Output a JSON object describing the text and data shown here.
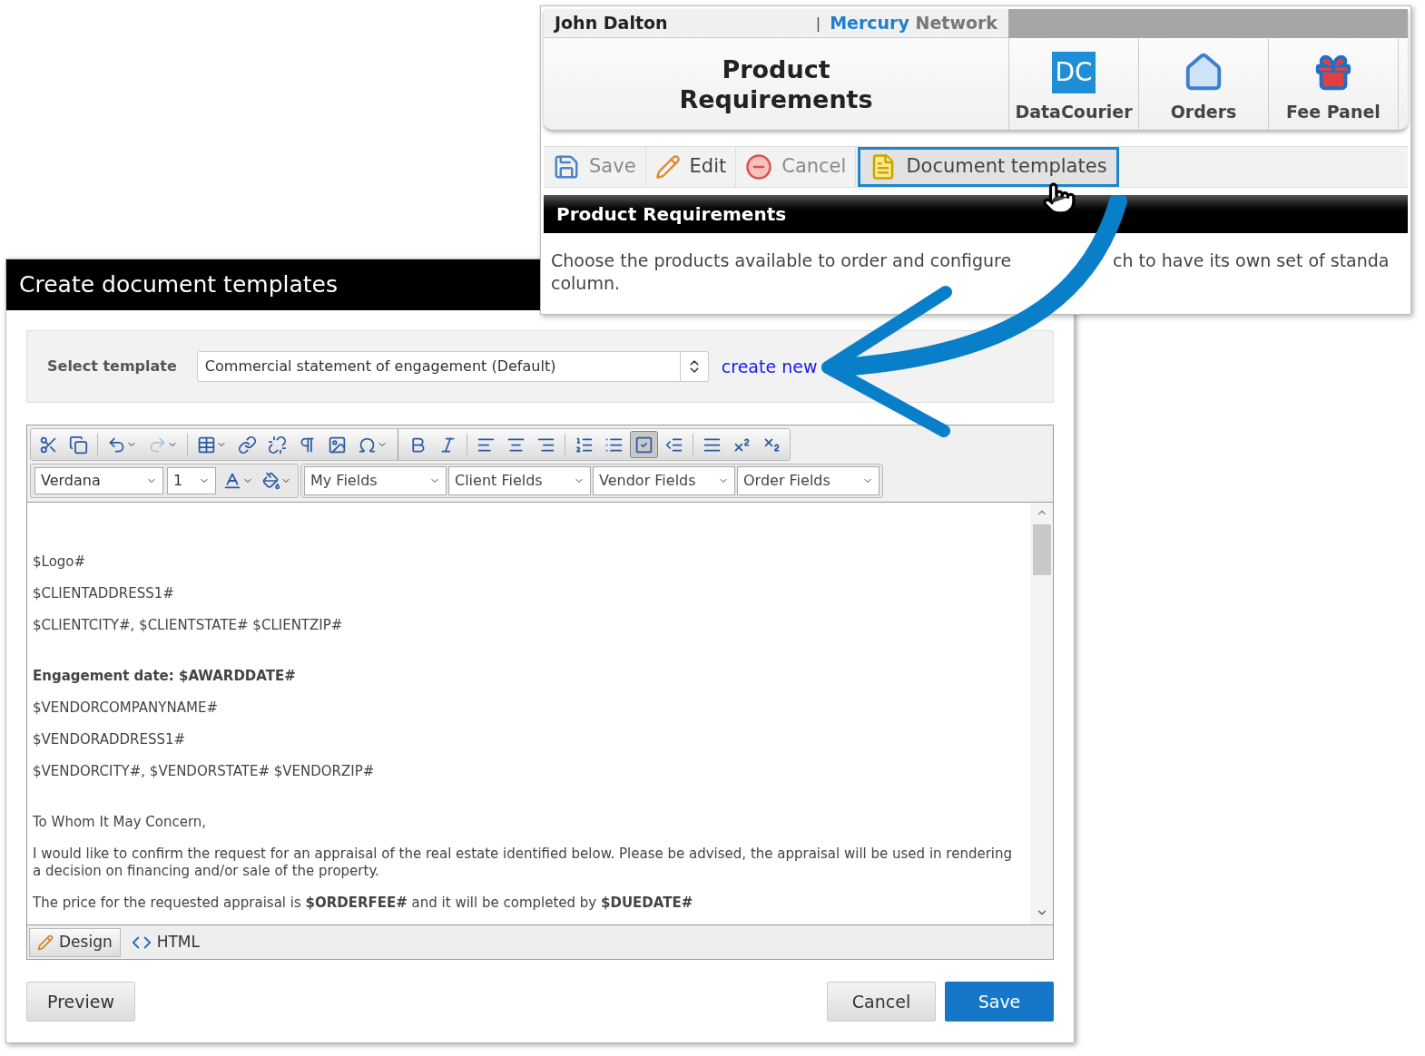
{
  "portal": {
    "user": "John Dalton",
    "separator": "|",
    "brand": [
      "Mercury",
      "Network"
    ],
    "page_title": "Product Requirements",
    "nav": [
      {
        "label": "DataCourier",
        "kind": "datacourier",
        "badge": "DC"
      },
      {
        "label": "Orders",
        "kind": "orders"
      },
      {
        "label": "Fee Panel",
        "kind": "fees"
      }
    ],
    "actions": [
      {
        "label": "Save",
        "kind": "save",
        "disabled": true,
        "selected": false
      },
      {
        "label": "Edit",
        "kind": "edit",
        "disabled": false,
        "selected": false
      },
      {
        "label": "Cancel",
        "kind": "cancel",
        "disabled": true,
        "selected": false
      },
      {
        "label": "Document templates",
        "kind": "templates",
        "disabled": false,
        "selected": true
      }
    ],
    "section_title": "Product Requirements",
    "description": [
      [
        "Choose the products available to order and configure",
        "ch to have its own set of standa"
      ],
      [
        "column."
      ]
    ]
  },
  "dialog": {
    "title": "Create document templates",
    "select_label": "Select template",
    "select_value": "Commercial statement of engagement (Default)",
    "create_link": "create new",
    "toolbar": [
      {
        "kind": "cut",
        "disabled": false,
        "selected": false
      },
      {
        "kind": "copy",
        "disabled": false,
        "selected": false
      },
      {
        "kind": "sep"
      },
      {
        "kind": "undo",
        "disabled": false,
        "selected": false
      },
      {
        "kind": "redo",
        "disabled": true,
        "selected": false
      },
      {
        "kind": "sep"
      },
      {
        "kind": "table",
        "disabled": false,
        "selected": false
      },
      {
        "kind": "link",
        "disabled": false,
        "selected": false
      },
      {
        "kind": "unlink",
        "disabled": false,
        "selected": false
      },
      {
        "kind": "paragraph",
        "disabled": false,
        "selected": false
      },
      {
        "kind": "image",
        "disabled": false,
        "selected": false
      },
      {
        "kind": "symbol",
        "disabled": false,
        "selected": false
      },
      {
        "kind": "group"
      },
      {
        "kind": "bold",
        "disabled": false,
        "selected": false
      },
      {
        "kind": "italic",
        "disabled": false,
        "selected": false
      },
      {
        "kind": "sep"
      },
      {
        "kind": "align-left",
        "disabled": false,
        "selected": false
      },
      {
        "kind": "align-center",
        "disabled": false,
        "selected": false
      },
      {
        "kind": "align-right",
        "disabled": false,
        "selected": false
      },
      {
        "kind": "sep"
      },
      {
        "kind": "ordered-list",
        "disabled": false,
        "selected": false
      },
      {
        "kind": "bullet-list",
        "disabled": false,
        "selected": false
      },
      {
        "kind": "toggle-borders",
        "disabled": false,
        "selected": true
      },
      {
        "kind": "outdent",
        "disabled": false,
        "selected": false
      },
      {
        "kind": "sep"
      },
      {
        "kind": "rule",
        "disabled": false,
        "selected": false
      },
      {
        "kind": "superscript",
        "disabled": false,
        "selected": false
      },
      {
        "kind": "subscript",
        "disabled": false,
        "selected": false
      }
    ],
    "font": "Verdana",
    "size": "1",
    "field_menus": [
      "My Fields",
      "Client Fields",
      "Vendor Fields",
      "Order Fields"
    ],
    "blocks": [
      [
        {
          "text": "$Logo#",
          "bold": false
        },
        {
          "text": "$CLIENTADDRESS1#",
          "bold": false
        },
        {
          "text": "$CLIENTCITY#, $CLIENTSTATE# $CLIENTZIP#",
          "bold": false
        }
      ],
      [
        {
          "text": "Engagement date: $AWARDDATE#",
          "bold": true
        },
        {
          "text": "$VENDORCOMPANYNAME#",
          "bold": false
        },
        {
          "text": "$VENDORADDRESS1#",
          "bold": false
        },
        {
          "text": "$VENDORCITY#, $VENDORSTATE# $VENDORZIP#",
          "bold": false
        }
      ],
      [
        {
          "text": "To Whom It May Concern,",
          "bold": false
        },
        {
          "text": "I would like to confirm the request for an appraisal of the real estate identified below. Please be advised, the appraisal will be used in rendering a decision on financing and/or sale of the property.",
          "bold": false
        },
        {
          "text": "The price for the requested appraisal is **$ORDERFEE#** and it will be completed by **$DUEDATE#**",
          "bold": false
        }
      ]
    ],
    "modes": [
      {
        "label": "Design",
        "kind": "design",
        "selected": true
      },
      {
        "label": "HTML",
        "kind": "html",
        "selected": false
      }
    ],
    "buttons": [
      {
        "label": "Preview",
        "kind": "secondary"
      },
      {
        "label": "Cancel",
        "kind": "secondary"
      },
      {
        "label": "Save",
        "kind": "primary"
      }
    ]
  }
}
